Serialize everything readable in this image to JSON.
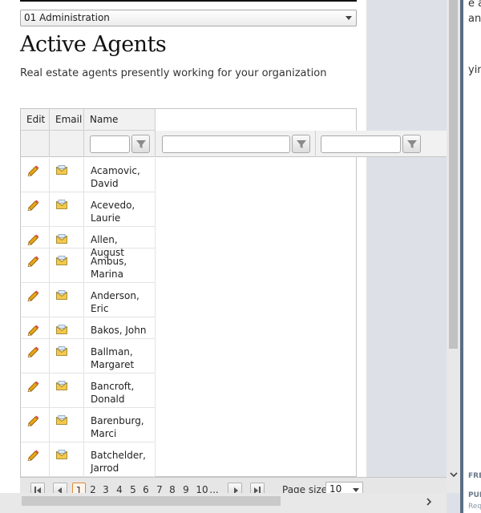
{
  "background_page": {
    "fragments": [
      "e a",
      "an",
      "ying"
    ],
    "small_labels": [
      "FREE",
      "PUR",
      "Req"
    ]
  },
  "department_select": {
    "value": "01 Administration"
  },
  "page": {
    "title": "Active Agents",
    "subtitle": "Real estate agents presently working for your organization"
  },
  "grid": {
    "columns": [
      "Edit",
      "Email",
      "Name"
    ],
    "rows": [
      {
        "name": "Acamovic, David"
      },
      {
        "name": "Acevedo, Laurie"
      },
      {
        "name": "Allen, August"
      },
      {
        "name": "Ambus, Marina"
      },
      {
        "name": "Anderson, Eric"
      },
      {
        "name": "Bakos, John"
      },
      {
        "name": "Ballman, Margaret"
      },
      {
        "name": "Bancroft, Donald"
      },
      {
        "name": "Barenburg, Marci"
      },
      {
        "name": "Batchelder, Jarrod"
      }
    ]
  },
  "pager": {
    "pages": [
      "1",
      "2",
      "3",
      "4",
      "5",
      "6",
      "7",
      "8",
      "9",
      "10",
      "..."
    ],
    "current_page": "1",
    "page_size_label": "Page size:",
    "page_size_value": "10"
  },
  "icons": {
    "edit": "pencil-icon",
    "email": "envelope-icon",
    "filter": "filter-icon"
  },
  "colors": {
    "pencil": "#e8a317",
    "envelope": "#f2c94c",
    "current_page_border": "#e08b3a"
  }
}
